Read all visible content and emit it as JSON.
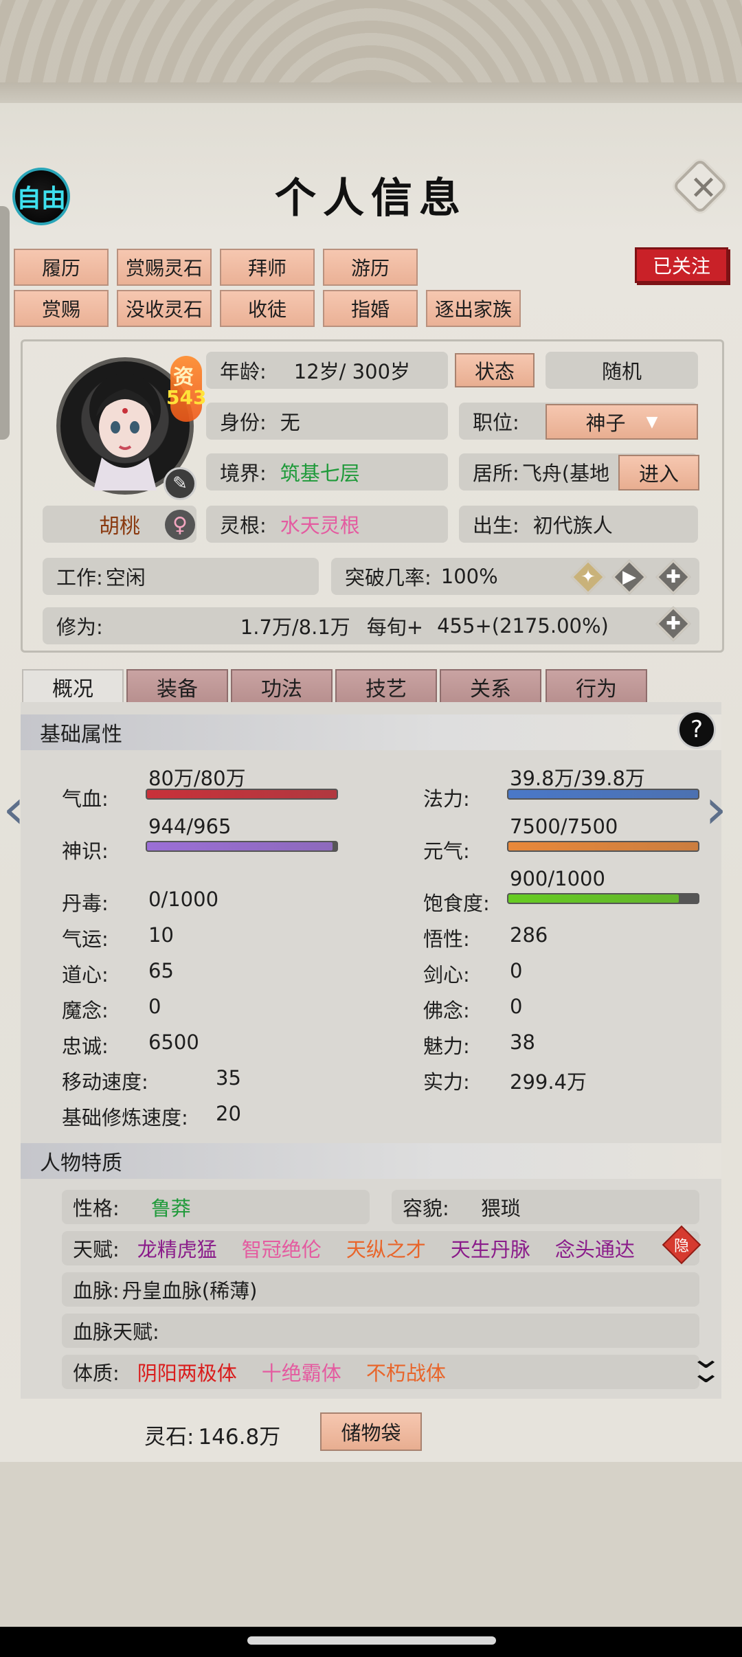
{
  "header": {
    "mode_badge": "自由",
    "title": "个人信息",
    "close_icon": "close-icon"
  },
  "actions": {
    "row1": [
      "履历",
      "赏赐灵石",
      "拜师",
      "游历"
    ],
    "row2": [
      "赏赐",
      "没收灵石",
      "收徒",
      "指婚",
      "逐出家族"
    ],
    "follow": "已关注"
  },
  "profile": {
    "aptitude_label": "资",
    "aptitude_value": "543",
    "name": "胡桃",
    "gender_icon": "female-icon",
    "age_label": "年龄:",
    "age_value": "12岁/ 300岁",
    "status_button": "状态",
    "random_button": "随机",
    "identity_label": "身份:",
    "identity_value": "无",
    "position_label": "职位:",
    "position_value": "神子",
    "realm_label": "境界:",
    "realm_value": "筑基七层",
    "residence_label": "居所:",
    "residence_value": "飞舟(基地",
    "enter_button": "进入",
    "root_label": "灵根:",
    "root_value": "水天灵根",
    "birth_label": "出生:",
    "birth_value": "初代族人",
    "work_label": "工作:",
    "work_value": "空闲",
    "breakthrough_label": "突破几率:",
    "breakthrough_value": "100%",
    "cultivation_label": "修为:",
    "cultivation_value": "1.7万/8.1万",
    "per_round_label": "每旬+",
    "per_round_value": "455+(2175.00%)"
  },
  "tabs": [
    {
      "label": "概况",
      "active": true
    },
    {
      "label": "装备",
      "active": false
    },
    {
      "label": "功法",
      "active": false
    },
    {
      "label": "技艺",
      "active": false
    },
    {
      "label": "关系",
      "active": false
    },
    {
      "label": "行为",
      "active": false
    }
  ],
  "basic": {
    "title": "基础属性",
    "bars": {
      "hp": {
        "label": "气血:",
        "value": "80万/80万",
        "fraction": 1.0,
        "color": "#c8313a"
      },
      "mana": {
        "label": "法力:",
        "value": "39.8万/39.8万",
        "fraction": 1.0,
        "color": "#4a78c8"
      },
      "sense": {
        "label": "神识:",
        "value": "944/965",
        "fraction": 0.978,
        "color": "#9b6fd6"
      },
      "vital": {
        "label": "元气:",
        "value": "7500/7500",
        "fraction": 1.0,
        "color": "#e8883a"
      },
      "satiety": {
        "label": "饱食度:",
        "value": "900/1000",
        "fraction": 0.9,
        "color": "#66cc22"
      }
    },
    "stats_left": [
      {
        "label": "丹毒:",
        "value": "0/1000"
      },
      {
        "label": "气运:",
        "value": "10"
      },
      {
        "label": "道心:",
        "value": "65"
      },
      {
        "label": "魔念:",
        "value": "0"
      },
      {
        "label": "忠诚:",
        "value": "6500"
      },
      {
        "label": "移动速度:",
        "value": "35"
      },
      {
        "label": "基础修炼速度:",
        "value": "20"
      }
    ],
    "stats_right": [
      {
        "label": "悟性:",
        "value": "286"
      },
      {
        "label": "剑心:",
        "value": "0"
      },
      {
        "label": "佛念:",
        "value": "0"
      },
      {
        "label": "魅力:",
        "value": "38"
      },
      {
        "label": "实力:",
        "value": "299.4万"
      }
    ]
  },
  "traits": {
    "title": "人物特质",
    "personality_label": "性格:",
    "personality_value": "鲁莽",
    "appearance_label": "容貌:",
    "appearance_value": "猥琐",
    "talent_label": "天赋:",
    "talents": [
      {
        "text": "龙精虎猛",
        "color": "#8a1c8a"
      },
      {
        "text": "智冠绝伦",
        "color": "#e45ba0"
      },
      {
        "text": "天纵之才",
        "color": "#e8652a"
      },
      {
        "text": "天生丹脉",
        "color": "#8a1c8a"
      },
      {
        "text": "念头通达",
        "color": "#8a1c8a"
      }
    ],
    "hide_label": "隐",
    "bloodline_label": "血脉:",
    "bloodline_value": "丹皇血脉(稀薄)",
    "bloodline_talent_label": "血脉天赋:",
    "physique_label": "体质:",
    "physiques": [
      {
        "text": "阴阳两极体",
        "color": "#d91c1c"
      },
      {
        "text": "十绝霸体",
        "color": "#e45ba0"
      },
      {
        "text": "不朽战体",
        "color": "#e8652a"
      }
    ]
  },
  "footer": {
    "stones_label": "灵石:",
    "stones_value": "146.8万",
    "storage_button": "储物袋"
  }
}
